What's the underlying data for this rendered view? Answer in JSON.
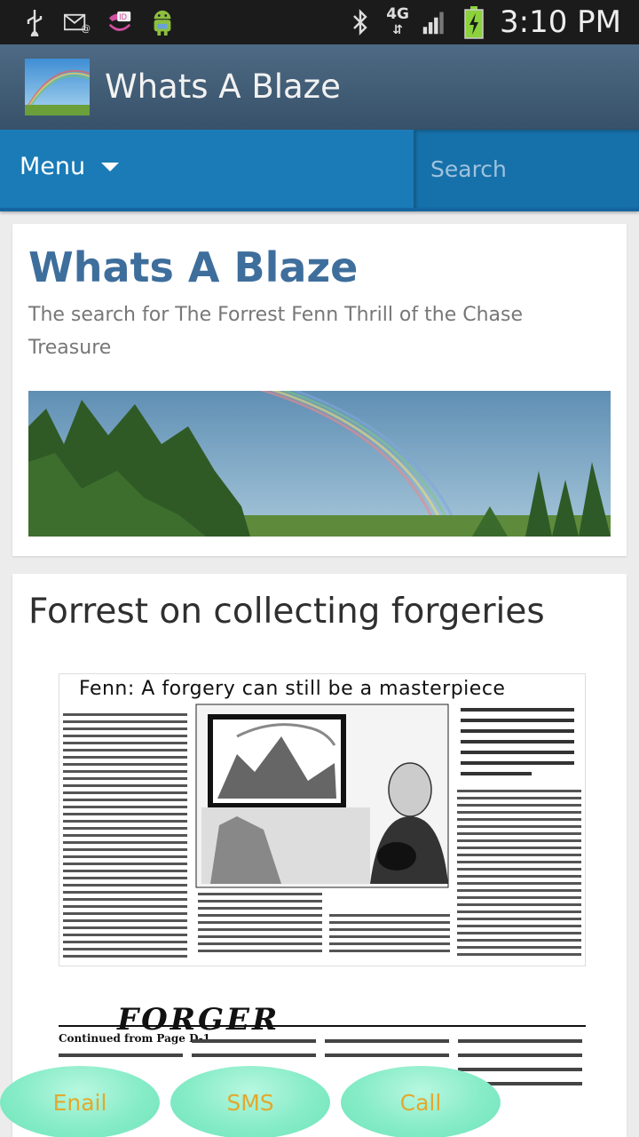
{
  "status_bar": {
    "time": "3:10 PM",
    "network": "4G",
    "icons": [
      "usb-icon",
      "email-icon",
      "voicemail-icon",
      "android-icon",
      "bluetooth-icon",
      "signal-icon",
      "battery-icon"
    ]
  },
  "app_bar": {
    "title": "Whats A Blaze"
  },
  "nav": {
    "menu_label": "Menu",
    "search_placeholder": "Search"
  },
  "header": {
    "site_title": "Whats A Blaze",
    "tagline": "The search for The Forrest Fenn Thrill of the Chase Treasure"
  },
  "post": {
    "title": "Forrest on collecting forgeries",
    "clipping1_headline": "Fenn: A forgery can still be a masterpiece",
    "clipping2_headline": "FORGER",
    "clipping2_sub": "Continued from Page D-1"
  },
  "actions": {
    "email": "Enail",
    "sms": "SMS",
    "call": "Call"
  },
  "colors": {
    "appbar": "#3e5a74",
    "navbar": "#1a7bb7",
    "title_blue": "#3e6e9c",
    "fab": "#86ecc7",
    "fab_text": "#e3a82d"
  }
}
